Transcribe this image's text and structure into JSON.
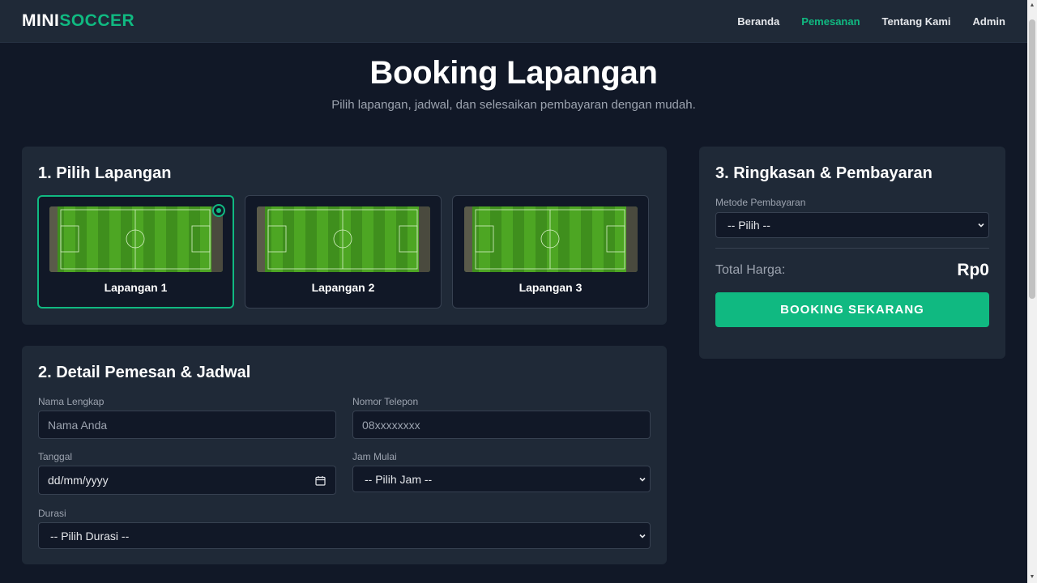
{
  "nav": {
    "logo_part1": "MINI",
    "logo_part2": "SOCCER",
    "links": [
      "Beranda",
      "Pemesanan",
      "Tentang Kami",
      "Admin"
    ]
  },
  "header": {
    "title": "Booking Lapangan",
    "subtitle": "Pilih lapangan, jadwal, dan selesaikan pembayaran dengan mudah."
  },
  "field_section": {
    "title": "1. Pilih Lapangan",
    "fields": [
      {
        "label": "Lapangan 1",
        "selected": true
      },
      {
        "label": "Lapangan 2",
        "selected": false
      },
      {
        "label": "Lapangan 3",
        "selected": false
      }
    ]
  },
  "detail_section": {
    "title": "2. Detail Pemesan & Jadwal",
    "name_label": "Nama Lengkap",
    "name_placeholder": "Nama Anda",
    "phone_label": "Nomor Telepon",
    "phone_placeholder": "08xxxxxxxx",
    "date_label": "Tanggal",
    "date_value": "dd/mm/yyyy",
    "time_label": "Jam Mulai",
    "time_value": "-- Pilih Jam --",
    "duration_label": "Durasi",
    "duration_value": "-- Pilih Durasi --"
  },
  "summary_section": {
    "title": "3. Ringkasan & Pembayaran",
    "payment_label": "Metode Pembayaran",
    "payment_value": "-- Pilih --",
    "total_label": "Total Harga:",
    "total_value": "Rp0",
    "button_label": "BOOKING SEKARANG"
  },
  "colors": {
    "accent": "#10b981",
    "background": "#111827",
    "card": "#1f2937"
  }
}
